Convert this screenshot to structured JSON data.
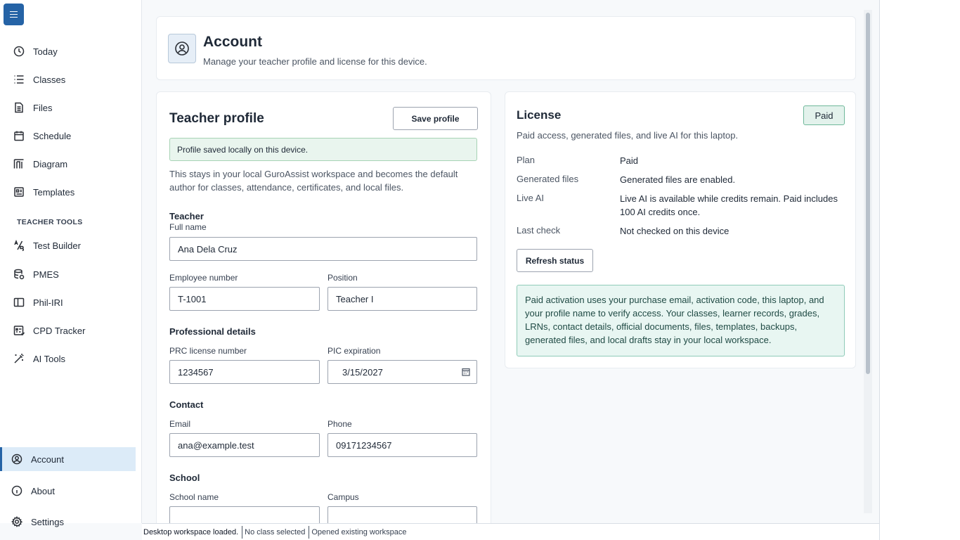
{
  "sidebar": {
    "items": [
      {
        "label": "Today",
        "icon": "clock-icon"
      },
      {
        "label": "Classes",
        "icon": "list-icon"
      },
      {
        "label": "Files",
        "icon": "file-icon"
      },
      {
        "label": "Schedule",
        "icon": "calendar-icon"
      },
      {
        "label": "Diagram",
        "icon": "diagram-icon"
      },
      {
        "label": "Templates",
        "icon": "template-icon"
      }
    ],
    "section_label": "TEACHER TOOLS",
    "tools": [
      {
        "label": "Test Builder",
        "icon": "test-builder-icon"
      },
      {
        "label": "PMES",
        "icon": "database-icon"
      },
      {
        "label": "Phil-IRI",
        "icon": "book-icon"
      },
      {
        "label": "CPD Tracker",
        "icon": "tracker-icon"
      },
      {
        "label": "AI Tools",
        "icon": "magic-wand-icon"
      }
    ],
    "bottom": [
      {
        "label": "Account",
        "icon": "user-circle-icon",
        "active": true
      },
      {
        "label": "About",
        "icon": "info-icon"
      },
      {
        "label": "Settings",
        "icon": "gear-icon"
      }
    ]
  },
  "header": {
    "title": "Account",
    "subtitle": "Manage your teacher profile and license for this device."
  },
  "profile": {
    "title": "Teacher profile",
    "save_label": "Save profile",
    "alert": "Profile saved locally on this device.",
    "description": "This stays in your local GuroAssist workspace and becomes the default author for classes, attendance, certificates, and local files.",
    "teacher_group": "Teacher",
    "full_name_label": "Full name",
    "full_name": "Ana Dela Cruz",
    "employee_number_label": "Employee number",
    "employee_number": "T-1001",
    "position_label": "Position",
    "position": "Teacher I",
    "professional_group": "Professional details",
    "prc_label": "PRC license number",
    "prc": "1234567",
    "pic_label": "PIC expiration",
    "pic": "3/15/2027",
    "contact_group": "Contact",
    "email_label": "Email",
    "email": "ana@example.test",
    "phone_label": "Phone",
    "phone": "09171234567",
    "school_group": "School",
    "school_name_label": "School name",
    "campus_label": "Campus"
  },
  "license": {
    "title": "License",
    "badge": "Paid",
    "subtitle": "Paid access, generated files, and live AI for this laptop.",
    "plan_label": "Plan",
    "plan": "Paid",
    "generated_label": "Generated files",
    "generated": "Generated files are enabled.",
    "live_ai_label": "Live AI",
    "live_ai": "Live AI is available while credits remain. Paid includes 100 AI credits once.",
    "last_check_label": "Last check",
    "last_check": "Not checked on this device",
    "refresh_label": "Refresh status",
    "note": "Paid activation uses your purchase email, activation code, this laptop, and your profile name to verify access. Your classes, learner records, grades, LRNs, contact details, official documents, files, templates, backups, generated files, and local drafts stay in your local workspace."
  },
  "status_bar": {
    "workspace": "Desktop workspace loaded.",
    "class": "No class selected",
    "opened": "Opened existing workspace"
  },
  "colors": {
    "accent": "#2563a6",
    "active_nav_bg": "#dcebf8",
    "success_bg": "#e9f5ee",
    "badge_bg": "#e3f2ec"
  }
}
